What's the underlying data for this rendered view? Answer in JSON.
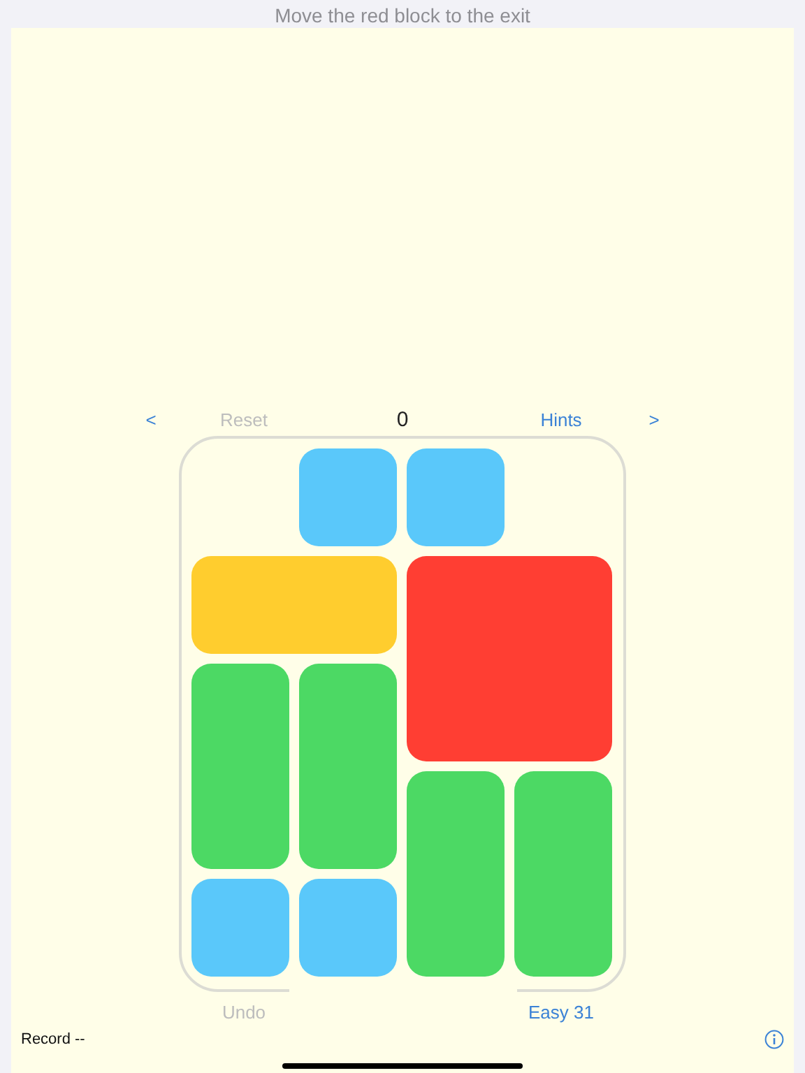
{
  "header": {
    "title": "Move the red block to the exit"
  },
  "controls": {
    "previous": "<",
    "reset": {
      "label": "Reset",
      "disabled": true
    },
    "moves": "0",
    "hints": {
      "label": "Hints",
      "disabled": false
    },
    "next": ">"
  },
  "board": {
    "blocks": [
      {
        "kind": "small",
        "color": "#5ac8fa"
      },
      {
        "kind": "small",
        "color": "#5ac8fa"
      },
      {
        "kind": "wide",
        "color": "#ffcd2e"
      },
      {
        "kind": "big",
        "color": "#ff3e33"
      },
      {
        "kind": "tall",
        "color": "#4cd964"
      },
      {
        "kind": "tall",
        "color": "#4cd964"
      },
      {
        "kind": "tall",
        "color": "#4cd964"
      },
      {
        "kind": "tall",
        "color": "#4cd964"
      },
      {
        "kind": "small",
        "color": "#5ac8fa"
      },
      {
        "kind": "small",
        "color": "#5ac8fa"
      }
    ]
  },
  "footer": {
    "undo": {
      "label": "Undo",
      "disabled": true
    },
    "level": {
      "label": "Easy 31",
      "disabled": false
    },
    "record": "Record --"
  }
}
